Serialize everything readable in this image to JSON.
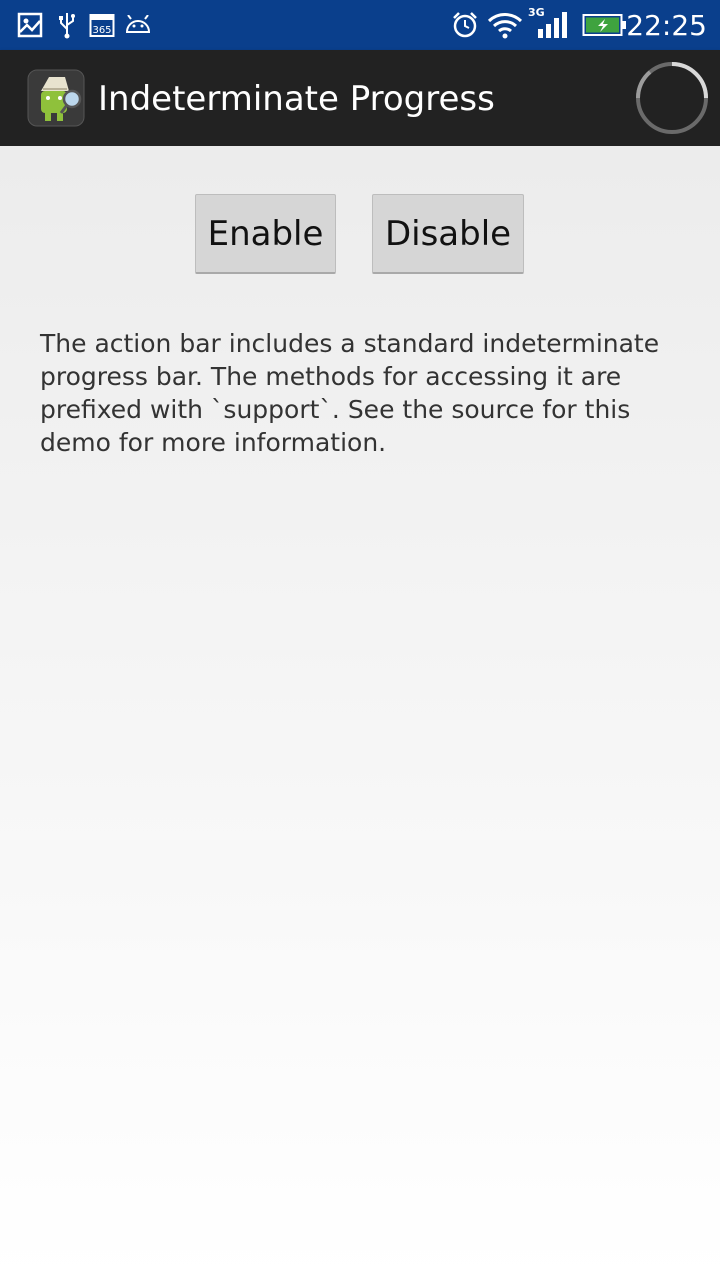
{
  "status_bar": {
    "time": "22:25",
    "network_label": "3G",
    "calendar_label": "365",
    "icons": [
      "image-icon",
      "usb-icon",
      "calendar-icon",
      "android-icon",
      "alarm-icon",
      "wifi-icon",
      "signal-icon",
      "battery-charging-icon"
    ]
  },
  "action_bar": {
    "title": "Indeterminate Progress",
    "app_icon": "app-logo-icon",
    "progress_indicator": "spinner-icon"
  },
  "buttons": {
    "enable_label": "Enable",
    "disable_label": "Disable"
  },
  "description": "The action bar includes a standard indeterminate progress bar. The methods for accessing it are prefixed with `support`. See the source for this demo for more information.",
  "colors": {
    "status_bar": "#0a3f8c",
    "action_bar": "#222222",
    "battery": "#3fa33f"
  }
}
